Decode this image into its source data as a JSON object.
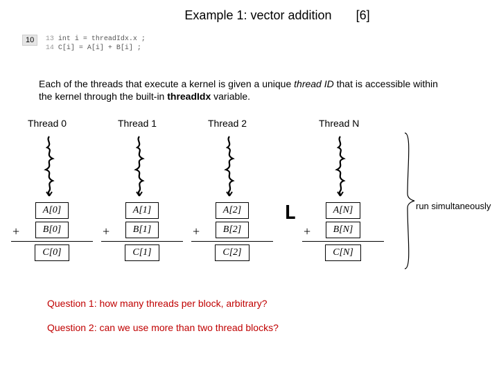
{
  "title": "Example 1: vector addition",
  "title_ref": "[6]",
  "slide_number": "10",
  "code": {
    "lines": [
      {
        "n": "13",
        "t": "int i = threadIdx.x ;"
      },
      {
        "n": "14",
        "t": "C[i] = A[i] + B[i] ;"
      }
    ]
  },
  "para_parts": {
    "p1": "Each of the threads that execute a kernel is given a unique ",
    "p2": "thread ID",
    "p3": " that is accessible within the kernel through the built-in ",
    "p4": "threadIdx",
    "p5": " variable."
  },
  "threads": [
    "Thread 0",
    "Thread 1",
    "Thread 2",
    "Thread N"
  ],
  "calc": [
    {
      "a": "A[0]",
      "b": "B[0]",
      "c": "C[0]"
    },
    {
      "a": "A[1]",
      "b": "B[1]",
      "c": "C[1]"
    },
    {
      "a": "A[2]",
      "b": "B[2]",
      "c": "C[2]"
    },
    {
      "a": "A[N]",
      "b": "B[N]",
      "c": "C[N]"
    }
  ],
  "plus": "+",
  "ellipsis_glyph": "L",
  "run_label": "run simultaneously",
  "q1": "Question 1: how many threads per block, arbitrary?",
  "q2": "Question 2: can we use more than two thread blocks?"
}
